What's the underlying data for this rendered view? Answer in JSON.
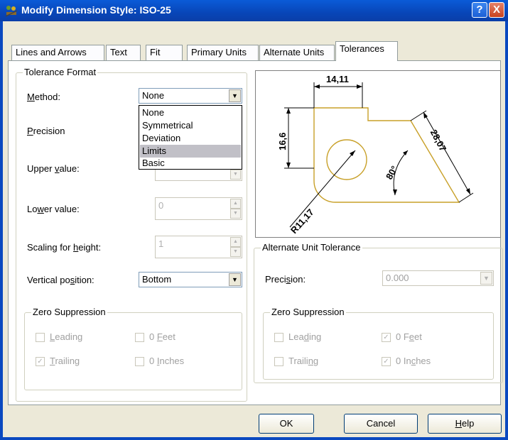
{
  "window": {
    "title": "Modify Dimension Style: ISO-25",
    "help_glyph": "?",
    "close_glyph": "X",
    "icon": "dimension-style-icon"
  },
  "tabs": [
    {
      "label": "Lines and Arrows"
    },
    {
      "label": "Text"
    },
    {
      "label": "Fit"
    },
    {
      "label": "Primary Units"
    },
    {
      "label": "Alternate Units"
    },
    {
      "label": "Tolerances",
      "active": true
    }
  ],
  "tolerance_format": {
    "title": "Tolerance Format",
    "method_label": "Method:",
    "method_value": "None",
    "method_options": [
      "None",
      "Symmetrical",
      "Deviation",
      "Limits",
      "Basic"
    ],
    "method_highlighted": "Limits",
    "precision_label": "Precision",
    "upper_label": "Upper value:",
    "lower_label": "Lower value:",
    "lower_value": "0",
    "scaling_label": "Scaling for height:",
    "scaling_value": "1",
    "vertical_label": "Vertical position:",
    "vertical_value": "Bottom",
    "zero_suppression": {
      "title": "Zero Suppression",
      "leading": {
        "label": "Leading",
        "checked": false
      },
      "trailing": {
        "label": "Trailing",
        "checked": true
      },
      "feet": {
        "label": "0 Feet",
        "checked": false
      },
      "inches": {
        "label": "0 Inches",
        "checked": false
      }
    }
  },
  "preview": {
    "dim_top": "14,11",
    "dim_left": "16,6",
    "dim_right": "28,07",
    "dim_angle": "80°",
    "dim_radius": "R11,17",
    "shape_color": "#c8a028"
  },
  "alternate_unit_tolerance": {
    "title": "Alternate Unit Tolerance",
    "precision_label": "Precision:",
    "precision_value": "0.000",
    "zero_suppression": {
      "title": "Zero Suppression",
      "leading": {
        "label": "Leading",
        "checked": false
      },
      "trailing": {
        "label": "Trailing",
        "checked": false
      },
      "feet": {
        "label": "0 Feet",
        "checked": true
      },
      "inches": {
        "label": "0 Inches",
        "checked": true
      }
    }
  },
  "buttons": {
    "ok": "OK",
    "cancel": "Cancel",
    "help": "Help"
  },
  "colors": {
    "titlebar": "#0a5bd8",
    "dropdown_highlight": "#c1c0c7"
  }
}
